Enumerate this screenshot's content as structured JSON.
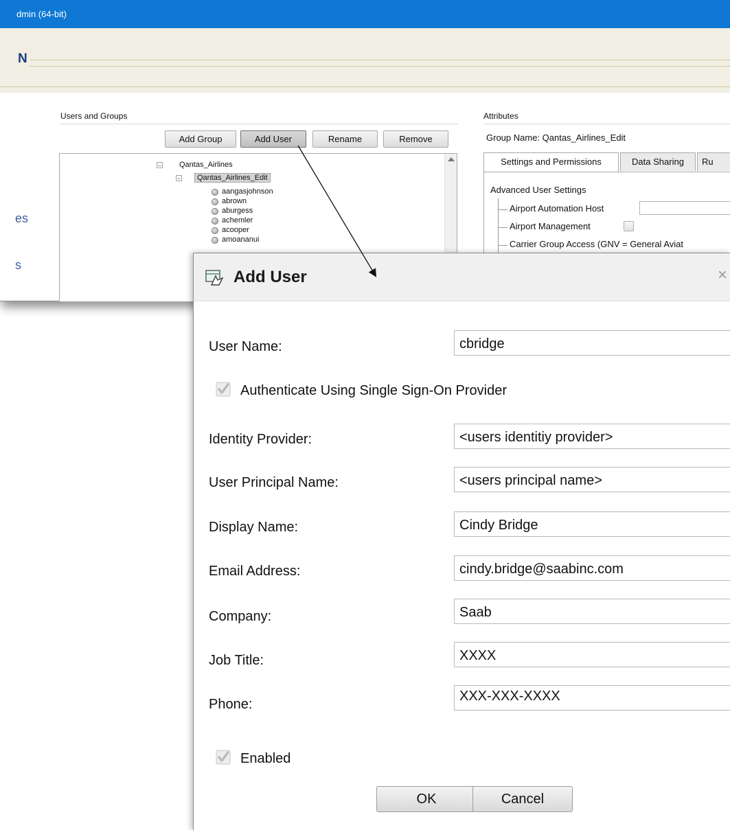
{
  "window": {
    "title": "dmin (64-bit)",
    "header_fragment": "N",
    "left_fragments": [
      "es",
      "s"
    ]
  },
  "users_groups": {
    "section_label": "Users and Groups",
    "buttons": {
      "add_group": "Add Group",
      "add_user": "Add User",
      "rename": "Rename",
      "remove": "Remove"
    },
    "tree": {
      "group": "Qantas_Airlines",
      "subgroup": "Qantas_Airlines_Edit",
      "users": [
        "aangasjohnson",
        "abrown",
        "aburgess",
        "achemler",
        "acooper",
        "amoananui"
      ]
    }
  },
  "attributes": {
    "section_label": "Attributes",
    "group_name": "Group Name: Qantas_Airlines_Edit",
    "tabs": [
      "Settings and Permissions",
      "Data Sharing",
      "Ru"
    ],
    "settings": {
      "heading": "Advanced User Settings",
      "items": [
        "Airport Automation Host",
        "Airport Management",
        "Carrier Group Access (GNV = General Aviat"
      ]
    }
  },
  "dialog": {
    "title": "Add User",
    "close": "×",
    "fields": {
      "user_name": {
        "label": "User Name:",
        "value": "cbridge"
      },
      "sso": {
        "label": "Authenticate Using Single Sign-On Provider",
        "checked": true
      },
      "identity_provider": {
        "label": "Identity Provider:",
        "value": "<users identitiy provider>"
      },
      "upn": {
        "label": "User Principal Name:",
        "value": "<users principal name>"
      },
      "display_name": {
        "label": "Display Name:",
        "value": "Cindy Bridge"
      },
      "email": {
        "label": "Email Address:",
        "value": "cindy.bridge@saabinc.com"
      },
      "company": {
        "label": "Company:",
        "value": "Saab"
      },
      "job_title": {
        "label": "Job Title:",
        "value": "XXXX"
      },
      "phone": {
        "label": "Phone:",
        "value": "XXX-XXX-XXXX"
      },
      "enabled": {
        "label": "Enabled",
        "checked": true
      }
    },
    "buttons": {
      "ok": "OK",
      "cancel": "Cancel"
    }
  },
  "colors": {
    "titlebar": "#0e78d4",
    "header_strip": "#f1efe3",
    "link_blue": "#1b3c86"
  }
}
